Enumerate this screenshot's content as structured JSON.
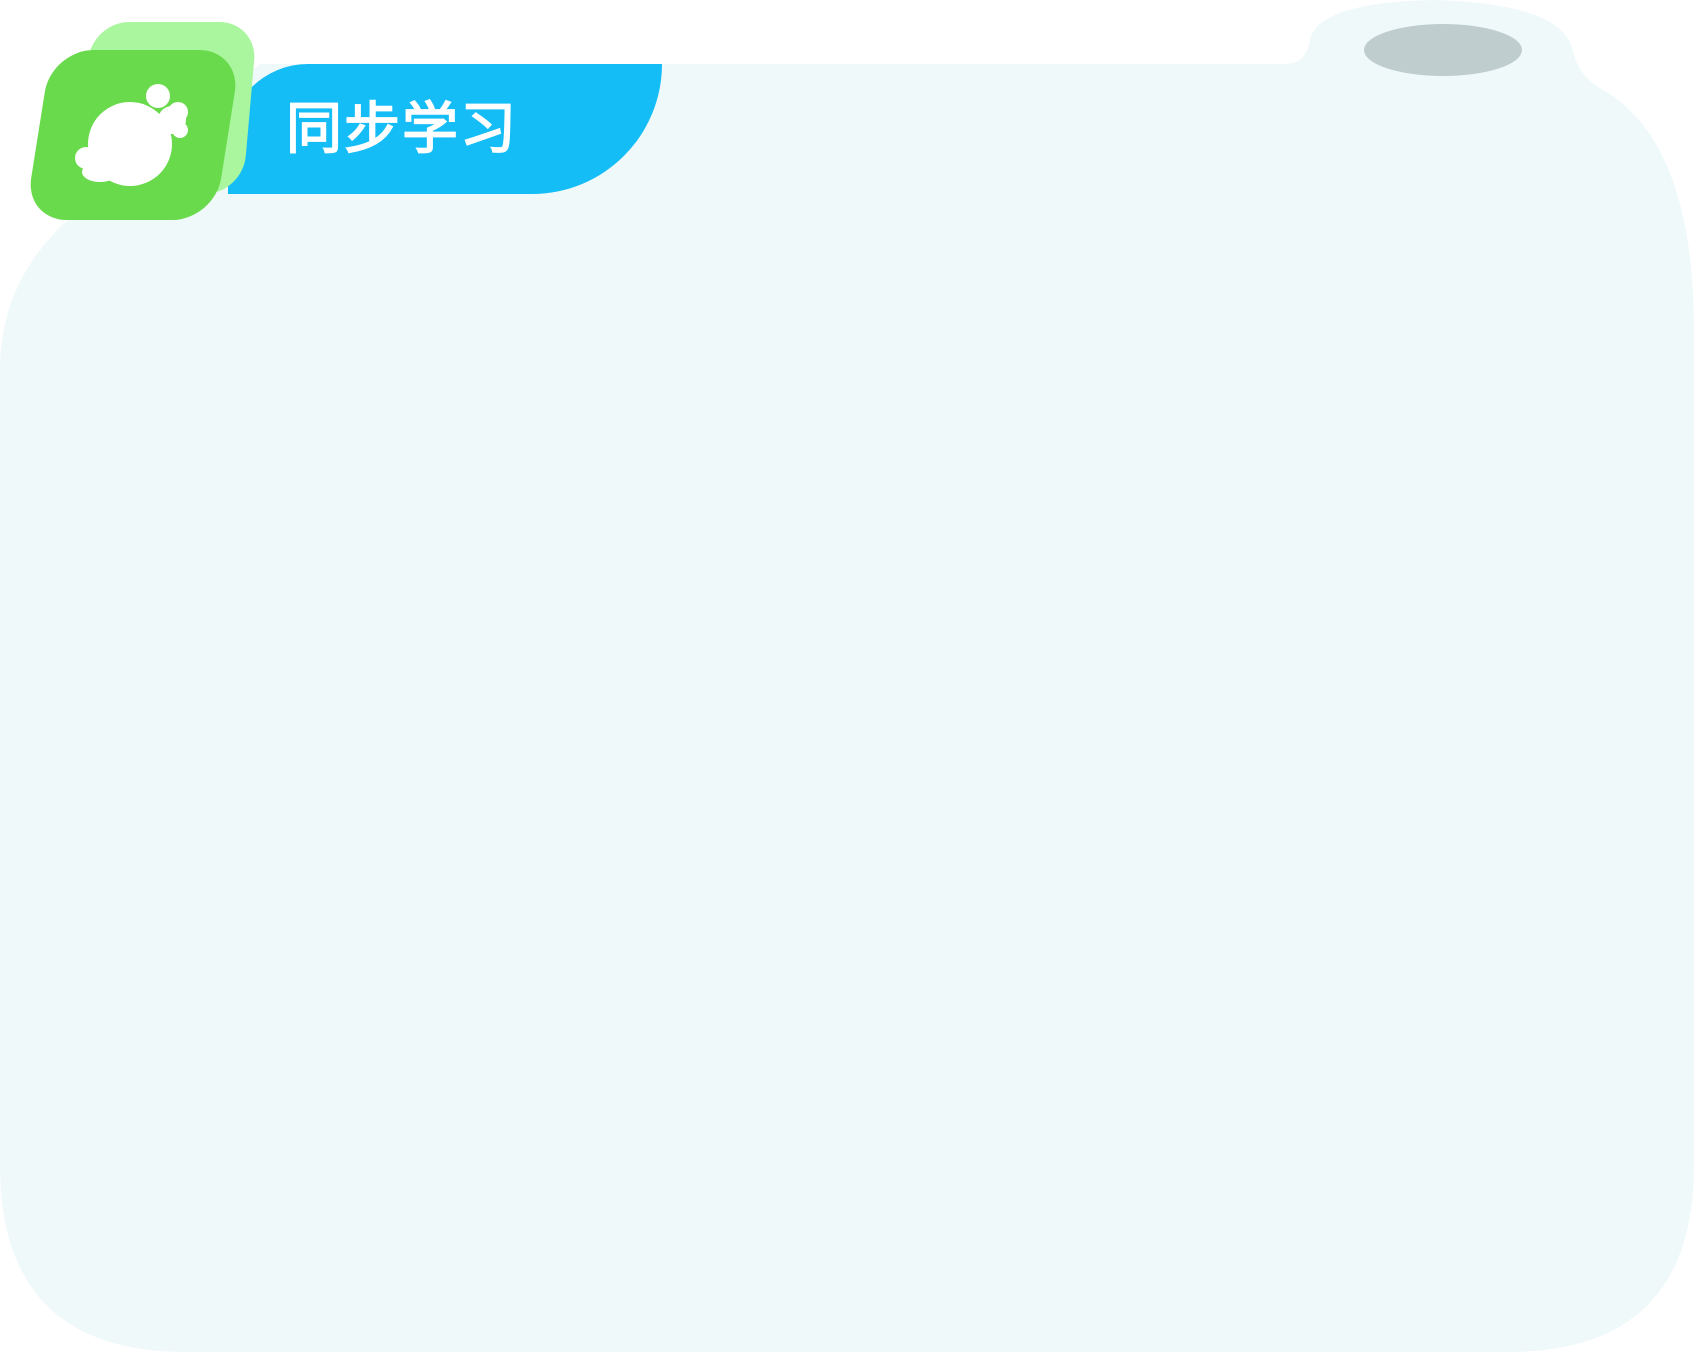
{
  "header": {
    "title": "同步学习"
  },
  "logo": {
    "icon": "lemon-icon"
  },
  "colors": {
    "panel_background": "#f0f9fa",
    "tab_accent": "#14bdf6",
    "logo_front": "#69da4b",
    "logo_back": "#a9f69e",
    "knob": "#bfcdcf"
  }
}
